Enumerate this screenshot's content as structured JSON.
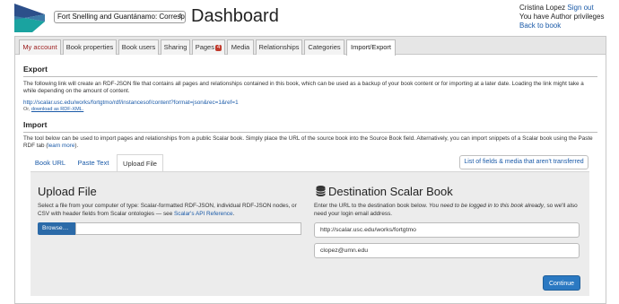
{
  "header": {
    "book_select_value": "Fort Snelling and Guantánamo: Corresp",
    "page_title": "Dashboard",
    "user_name": "Cristina Lopez",
    "sign_out_label": "Sign out",
    "privileges_text": "You have Author privileges",
    "back_to_book_label": "Back to book"
  },
  "tabs": [
    {
      "label": "My account"
    },
    {
      "label": "Book properties"
    },
    {
      "label": "Book users"
    },
    {
      "label": "Sharing"
    },
    {
      "label": "Pages",
      "badge": "4"
    },
    {
      "label": "Media"
    },
    {
      "label": "Relationships"
    },
    {
      "label": "Categories"
    },
    {
      "label": "Import/Export"
    }
  ],
  "export": {
    "heading": "Export",
    "description": "The following link will create an RDF-JSON file that contains all pages and relationships contained in this book, which can be used as a backup of your book content or for importing at a later date. Loading the link might take a while depending on the amount of content.",
    "url": "http://scalar.usc.edu/works/fortgtmo/rdf/instancesof/content?format=json&rec=1&ref=1",
    "or_text": "Or,",
    "rdf_xml_link": "download as RDF-XML."
  },
  "import": {
    "heading": "Import",
    "description_pre": "The tool below can be used to import pages and relationships from a public Scalar book. Simply place the URL of the source book into the Source Book field. Alternatively, you can import snippets of a Scalar book using the Paste RDF tab (",
    "learn_more": "learn more",
    "description_post": ")."
  },
  "import_tabs": [
    {
      "label": "Book URL"
    },
    {
      "label": "Paste Text"
    },
    {
      "label": "Upload File"
    }
  ],
  "fields_button_label": "List of fields & media that aren't transferred",
  "upload": {
    "heading": "Upload File",
    "description": "Select a file from your computer of type: Scalar-formatted RDF-JSON, individual RDF-JSON nodes, or CSV with header fields from Scalar ontologies — see ",
    "api_link": "Scalar's API Reference",
    "description_end": ".",
    "browse_label": "Browse…"
  },
  "destination": {
    "heading": "Destination Scalar Book",
    "description_pre": "Enter the URL to the destination book below. ",
    "description_em": "You need to be logged in to this book already",
    "description_post": ", so we'll also need your login email address.",
    "url_value": "http://scalar.usc.edu/works/fortgtmo",
    "email_value": "clopez@umn.edu",
    "continue_label": "Continue"
  },
  "colors": {
    "accent": "#2b79c2",
    "link": "#1a5aa8",
    "badge": "#c0392b",
    "my_account": "#9b1b1b"
  }
}
